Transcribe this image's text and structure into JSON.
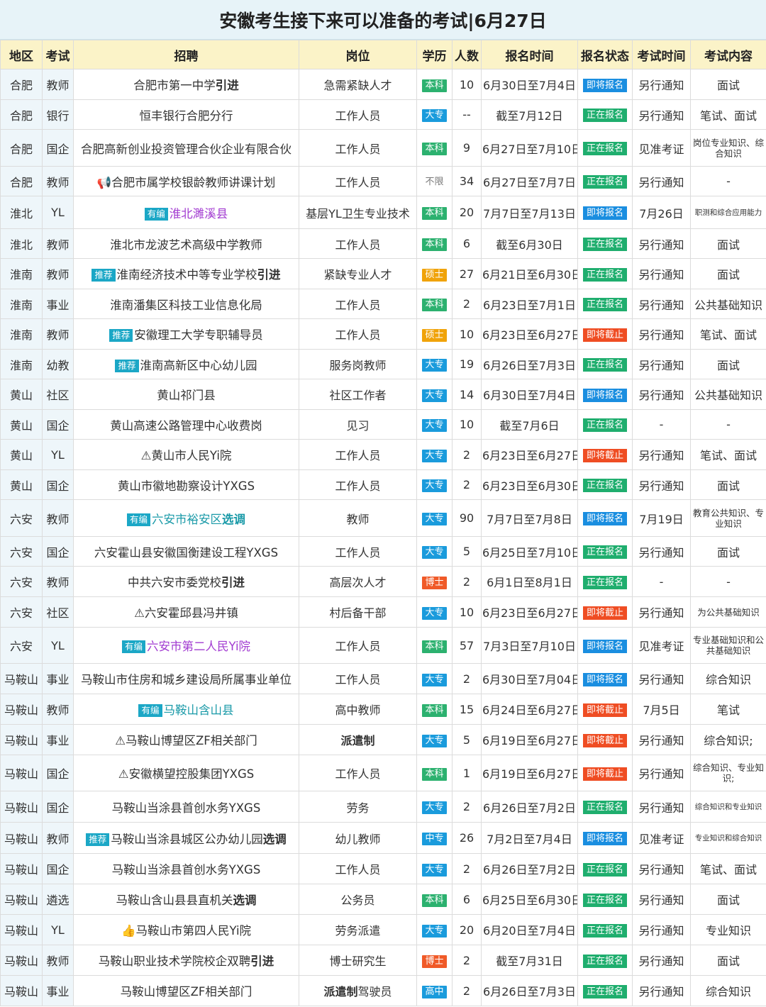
{
  "title": "安徽考生接下来可以准备的考试|6月27日",
  "headers": [
    "地区",
    "考试",
    "招聘",
    "岗位",
    "学历",
    "人数",
    "报名时间",
    "报名状态",
    "考试时间",
    "考试内容"
  ],
  "rows": [
    {
      "region": "合肥",
      "type": "教师",
      "prefix": "",
      "tag": "",
      "name": "合肥市第一中学",
      "suffix": "引进",
      "name_color": "",
      "position": "急需紧缺人才",
      "position_bold": false,
      "edu": "本科",
      "edu_color": "green",
      "count": "10",
      "period": "6月30日至7月4日",
      "status": "即将报名",
      "status_color": "blue",
      "exam": "另行通知",
      "content": "面试",
      "content_size": "normal",
      "h": 43
    },
    {
      "region": "合肥",
      "type": "银行",
      "prefix": "",
      "tag": "",
      "name": "恒丰银行合肥分行",
      "suffix": "",
      "name_color": "",
      "position": "工作人员",
      "position_bold": false,
      "edu": "大专",
      "edu_color": "blue",
      "count": "--",
      "period": "截至7月12日",
      "status": "正在报名",
      "status_color": "green",
      "exam": "另行通知",
      "content": "笔试、面试",
      "content_size": "normal",
      "h": 42
    },
    {
      "region": "合肥",
      "type": "国企",
      "prefix": "",
      "tag": "",
      "name": "合肥高新创业投资管理合伙企业有限合伙",
      "suffix": "",
      "name_color": "",
      "position": "工作人员",
      "position_bold": false,
      "edu": "本科",
      "edu_color": "green",
      "count": "9",
      "period": "6月27日至7月10日",
      "status": "正在报名",
      "status_color": "green",
      "exam": "见准考证",
      "content": "岗位专业知识、综合知识",
      "content_size": "small",
      "h": 52
    },
    {
      "region": "合肥",
      "type": "教师",
      "prefix": "📢",
      "tag": "",
      "name": "合肥市属学校银龄教师讲课计划",
      "suffix": "",
      "name_color": "",
      "position": "工作人员",
      "position_bold": false,
      "edu": "不限",
      "edu_color": "gray",
      "count": "34",
      "period": "6月27日至7月7日",
      "status": "正在报名",
      "status_color": "green",
      "exam": "另行通知",
      "content": "-",
      "content_size": "normal",
      "h": 42
    },
    {
      "region": "淮北",
      "type": "YL",
      "prefix": "",
      "tag": "有编",
      "name": "淮北濉溪县",
      "suffix": "",
      "name_color": "purple",
      "position": "基层YL卫生专业技术",
      "position_bold": false,
      "edu": "本科",
      "edu_color": "green",
      "count": "20",
      "period": "7月7日至7月13日",
      "status": "即将报名",
      "status_color": "blue",
      "exam": "7月26日",
      "content": "职测和综合应用能力",
      "content_size": "tiny",
      "h": 46
    },
    {
      "region": "淮北",
      "type": "教师",
      "prefix": "",
      "tag": "",
      "name": "淮北市龙波艺术高级中学教师",
      "suffix": "",
      "name_color": "",
      "position": "工作人员",
      "position_bold": false,
      "edu": "本科",
      "edu_color": "green",
      "count": "6",
      "period": "截至6月30日",
      "status": "正在报名",
      "status_color": "green",
      "exam": "另行通知",
      "content": "面试",
      "content_size": "normal",
      "h": 42
    },
    {
      "region": "淮南",
      "type": "教师",
      "prefix": "",
      "tag": "推荐",
      "name": "淮南经济技术中等专业学校",
      "suffix": "引进",
      "name_color": "",
      "position": "紧缺专业人才",
      "position_bold": false,
      "edu": "硕士",
      "edu_color": "orange",
      "count": "27",
      "period": "6月21日至6月30日",
      "status": "正在报名",
      "status_color": "green",
      "exam": "另行通知",
      "content": "面试",
      "content_size": "normal",
      "h": 43
    },
    {
      "region": "淮南",
      "type": "事业",
      "prefix": "",
      "tag": "",
      "name": "淮南潘集区科技工业信息化局",
      "suffix": "",
      "name_color": "",
      "position": "工作人员",
      "position_bold": false,
      "edu": "本科",
      "edu_color": "green",
      "count": "2",
      "period": "6月23日至7月1日",
      "status": "正在报名",
      "status_color": "green",
      "exam": "另行通知",
      "content": "公共基础知识",
      "content_size": "normal",
      "h": 42
    },
    {
      "region": "淮南",
      "type": "教师",
      "prefix": "",
      "tag": "推荐",
      "name": "安徽理工大学专职辅导员",
      "suffix": "",
      "name_color": "",
      "position": "工作人员",
      "position_bold": false,
      "edu": "硕士",
      "edu_color": "orange",
      "count": "10",
      "period": "6月23日至6月27日",
      "status": "即将截止",
      "status_color": "red",
      "exam": "另行通知",
      "content": "笔试、面试",
      "content_size": "normal",
      "h": 43
    },
    {
      "region": "淮南",
      "type": "幼教",
      "prefix": "",
      "tag": "推荐",
      "name": "淮南高新区中心幼儿园",
      "suffix": "",
      "name_color": "",
      "position": "服务岗教师",
      "position_bold": false,
      "edu": "大专",
      "edu_color": "blue",
      "count": "19",
      "period": "6月26日至7月3日",
      "status": "正在报名",
      "status_color": "green",
      "exam": "另行通知",
      "content": "面试",
      "content_size": "normal",
      "h": 42
    },
    {
      "region": "黄山",
      "type": "社区",
      "prefix": "",
      "tag": "",
      "name": "黄山祁门县",
      "suffix": "",
      "name_color": "",
      "position": "社区工作者",
      "position_bold": false,
      "edu": "大专",
      "edu_color": "blue",
      "count": "14",
      "period": "6月30日至7月4日",
      "status": "即将报名",
      "status_color": "blue",
      "exam": "另行通知",
      "content": "公共基础知识",
      "content_size": "normal",
      "h": 43
    },
    {
      "region": "黄山",
      "type": "国企",
      "prefix": "",
      "tag": "",
      "name": "黄山高速公路管理中心收费岗",
      "suffix": "",
      "name_color": "",
      "position": "见习",
      "position_bold": false,
      "edu": "大专",
      "edu_color": "blue",
      "count": "10",
      "period": "截至7月6日",
      "status": "正在报名",
      "status_color": "green",
      "exam": "-",
      "content": "-",
      "content_size": "normal",
      "h": 42
    },
    {
      "region": "黄山",
      "type": "YL",
      "prefix": "⚠",
      "tag": "",
      "name": "黄山市人民Yi院",
      "suffix": "",
      "name_color": "",
      "position": "工作人员",
      "position_bold": false,
      "edu": "大专",
      "edu_color": "blue",
      "count": "2",
      "period": "6月23日至6月27日",
      "status": "即将截止",
      "status_color": "red",
      "exam": "另行通知",
      "content": "笔试、面试",
      "content_size": "normal",
      "h": 43
    },
    {
      "region": "黄山",
      "type": "国企",
      "prefix": "",
      "tag": "",
      "name": "黄山市徽地勘察设计YXGS",
      "suffix": "",
      "name_color": "",
      "position": "工作人员",
      "position_bold": false,
      "edu": "大专",
      "edu_color": "blue",
      "count": "2",
      "period": "6月23日至6月30日",
      "status": "正在报名",
      "status_color": "green",
      "exam": "另行通知",
      "content": "面试",
      "content_size": "normal",
      "h": 42
    },
    {
      "region": "六安",
      "type": "教师",
      "prefix": "",
      "tag": "有编",
      "name": "六安市裕安区",
      "suffix": "选调",
      "name_color": "teal",
      "position": "教师",
      "position_bold": false,
      "edu": "大专",
      "edu_color": "blue",
      "count": "90",
      "period": "7月7日至7月8日",
      "status": "即将报名",
      "status_color": "blue",
      "exam": "7月19日",
      "content": "教育公共知识、专业知识",
      "content_size": "small",
      "h": 52
    },
    {
      "region": "六安",
      "type": "国企",
      "prefix": "",
      "tag": "",
      "name": "六安霍山县安徽国衡建设工程YXGS",
      "suffix": "",
      "name_color": "",
      "position": "工作人员",
      "position_bold": false,
      "edu": "大专",
      "edu_color": "blue",
      "count": "5",
      "period": "6月25日至7月10日",
      "status": "正在报名",
      "status_color": "green",
      "exam": "另行通知",
      "content": "面试",
      "content_size": "normal",
      "h": 42
    },
    {
      "region": "六安",
      "type": "教师",
      "prefix": "",
      "tag": "",
      "name": "中共六安市委党校",
      "suffix": "引进",
      "name_color": "",
      "position": "高层次人才",
      "position_bold": false,
      "edu": "博士",
      "edu_color": "red",
      "count": "2",
      "period": "6月1日至8月1日",
      "status": "正在报名",
      "status_color": "green",
      "exam": "-",
      "content": "-",
      "content_size": "normal",
      "h": 43
    },
    {
      "region": "六安",
      "type": "社区",
      "prefix": "⚠",
      "tag": "",
      "name": "六安霍邱县冯井镇",
      "suffix": "",
      "name_color": "",
      "position": "村后备干部",
      "position_bold": false,
      "edu": "大专",
      "edu_color": "blue",
      "count": "10",
      "period": "6月23日至6月27日",
      "status": "即将截止",
      "status_color": "red",
      "exam": "另行通知",
      "content": "为公共基础知识",
      "content_size": "small",
      "h": 43
    },
    {
      "region": "六安",
      "type": "YL",
      "prefix": "",
      "tag": "有编",
      "name": "六安市第二人民Yi院",
      "suffix": "",
      "name_color": "purple",
      "position": "工作人员",
      "position_bold": false,
      "edu": "本科",
      "edu_color": "green",
      "count": "57",
      "period": "7月3日至7月10日",
      "status": "即将报名",
      "status_color": "blue",
      "exam": "见准考证",
      "content": "专业基础知识和公共基础知识",
      "content_size": "small",
      "h": 51
    },
    {
      "region": "马鞍山",
      "type": "事业",
      "prefix": "",
      "tag": "",
      "name": "马鞍山市住房和城乡建设局所属事业单位",
      "suffix": "",
      "name_color": "",
      "position": "工作人员",
      "position_bold": false,
      "edu": "大专",
      "edu_color": "blue",
      "count": "2",
      "period": "6月30日至7月04日",
      "status": "即将报名",
      "status_color": "blue",
      "exam": "另行通知",
      "content": "综合知识",
      "content_size": "normal",
      "h": 43
    },
    {
      "region": "马鞍山",
      "type": "教师",
      "prefix": "",
      "tag": "有编",
      "name": "马鞍山含山县",
      "suffix": "",
      "name_color": "teal",
      "position": "高中教师",
      "position_bold": false,
      "edu": "本科",
      "edu_color": "green",
      "count": "15",
      "period": "6月24日至6月27日",
      "status": "即将截止",
      "status_color": "red",
      "exam": "7月5日",
      "content": "笔试",
      "content_size": "normal",
      "h": 43
    },
    {
      "region": "马鞍山",
      "type": "事业",
      "prefix": "⚠",
      "tag": "",
      "name": "马鞍山博望区ZF相关部门",
      "suffix": "",
      "name_color": "",
      "position": "派遣制",
      "position_bold": true,
      "edu": "大专",
      "edu_color": "blue",
      "count": "5",
      "period": "6月19日至6月27日",
      "status": "即将截止",
      "status_color": "red",
      "exam": "另行通知",
      "content": "综合知识;",
      "content_size": "normal",
      "h": 43
    },
    {
      "region": "马鞍山",
      "type": "国企",
      "prefix": "⚠",
      "tag": "",
      "name": "安徽横望控股集团YXGS",
      "suffix": "",
      "name_color": "",
      "position": "工作人员",
      "position_bold": false,
      "edu": "本科",
      "edu_color": "green",
      "count": "1",
      "period": "6月19日至6月27日",
      "status": "即将截止",
      "status_color": "red",
      "exam": "另行通知",
      "content": "综合知识、专业知识;",
      "content_size": "small",
      "h": 51
    },
    {
      "region": "马鞍山",
      "type": "国企",
      "prefix": "",
      "tag": "",
      "name": "马鞍山当涂县首创水务YXGS",
      "suffix": "",
      "name_color": "",
      "position": "劳务",
      "position_bold": false,
      "edu": "大专",
      "edu_color": "blue",
      "count": "2",
      "period": "6月26日至7月2日",
      "status": "正在报名",
      "status_color": "green",
      "exam": "另行通知",
      "content": "综合知识和专业知识",
      "content_size": "tiny",
      "h": 44
    },
    {
      "region": "马鞍山",
      "type": "教师",
      "prefix": "",
      "tag": "推荐",
      "name": "马鞍山当涂县城区公办幼儿园",
      "suffix": "选调",
      "name_color": "",
      "position": "幼儿教师",
      "position_bold": false,
      "edu": "中专",
      "edu_color": "blue",
      "count": "26",
      "period": "7月2日至7月4日",
      "status": "即将报名",
      "status_color": "blue",
      "exam": "见准考证",
      "content": "专业知识和综合知识",
      "content_size": "tiny",
      "h": 44
    },
    {
      "region": "马鞍山",
      "type": "国企",
      "prefix": "",
      "tag": "",
      "name": "马鞍山当涂县首创水务YXGS",
      "suffix": "",
      "name_color": "",
      "position": "工作人员",
      "position_bold": false,
      "edu": "大专",
      "edu_color": "blue",
      "count": "2",
      "period": "6月26日至7月2日",
      "status": "正在报名",
      "status_color": "green",
      "exam": "另行通知",
      "content": "笔试、面试",
      "content_size": "normal",
      "h": 43
    },
    {
      "region": "马鞍山",
      "type": "遴选",
      "prefix": "",
      "tag": "",
      "name": "马鞍山含山县县直机关",
      "suffix": "选调",
      "name_color": "",
      "position": "公务员",
      "position_bold": false,
      "edu": "本科",
      "edu_color": "green",
      "count": "6",
      "period": "6月25日至6月30日",
      "status": "正在报名",
      "status_color": "green",
      "exam": "另行通知",
      "content": "面试",
      "content_size": "normal",
      "h": 43
    },
    {
      "region": "马鞍山",
      "type": "YL",
      "prefix": "👍",
      "tag": "",
      "name": "马鞍山市第四人民Yi院",
      "suffix": "",
      "name_color": "",
      "position": "劳务派遣",
      "position_bold": false,
      "edu": "大专",
      "edu_color": "blue",
      "count": "20",
      "period": "6月20日至7月4日",
      "status": "正在报名",
      "status_color": "green",
      "exam": "另行通知",
      "content": "专业知识",
      "content_size": "normal",
      "h": 43
    },
    {
      "region": "马鞍山",
      "type": "教师",
      "prefix": "",
      "tag": "",
      "name": "马鞍山职业技术学院校企双聘",
      "suffix": "引进",
      "name_color": "",
      "position": "博士研究生",
      "position_bold": false,
      "edu": "博士",
      "edu_color": "red",
      "count": "2",
      "period": "截至7月31日",
      "status": "正在报名",
      "status_color": "green",
      "exam": "另行通知",
      "content": "面试",
      "content_size": "normal",
      "h": 43
    },
    {
      "region": "马鞍山",
      "type": "事业",
      "prefix": "",
      "tag": "",
      "name": "马鞍山博望区ZF相关部门",
      "suffix": "",
      "name_color": "",
      "position": "派遣制驾驶员",
      "position_bold": false,
      "position_bold_part": "派遣制",
      "edu": "高中",
      "edu_color": "blue",
      "count": "2",
      "period": "6月26日至7月3日",
      "status": "正在报名",
      "status_color": "green",
      "exam": "另行通知",
      "content": "综合知识",
      "content_size": "normal",
      "h": 43
    }
  ]
}
